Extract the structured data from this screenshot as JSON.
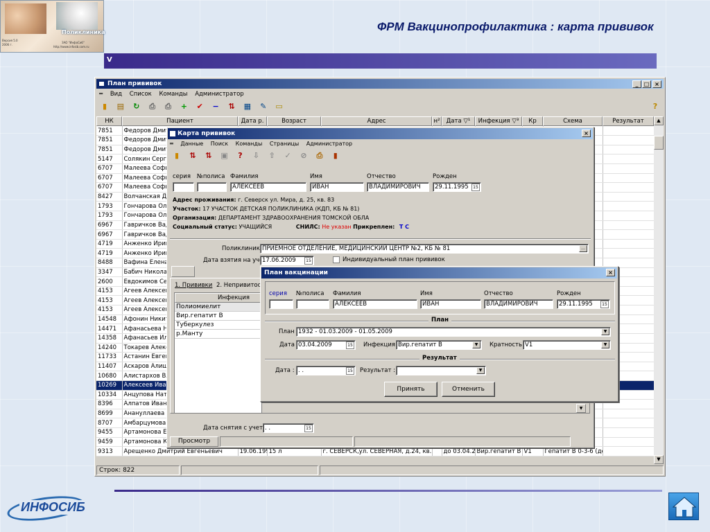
{
  "slide": {
    "title": "ФРМ Вакцинопрофилактика : карта прививок",
    "logo_text": "ИНФОСИБ",
    "tag": "V",
    "banner_brand": "Поликлиника",
    "banner_lines": [
      "Версия 5.0",
      "2006 г.",
      "ЗАО \"ИнфоСиб\"",
      "http://www.infosib.com.ru"
    ]
  },
  "main_window": {
    "title": "План прививок",
    "menu": [
      "Вид",
      "Список",
      "Команды",
      "Администратор"
    ],
    "columns": [
      "НК",
      "Пациент",
      "Дата р.",
      "Возраст",
      "Адрес",
      "н²",
      "Дата",
      "Инфекция",
      "Кр",
      "Схема",
      "Результат"
    ],
    "col_sort": {
      "date": "▽¹",
      "inf": "▽³"
    },
    "rows": [
      [
        "7851",
        "Федоров Дмитрий"
      ],
      [
        "7851",
        "Федоров Дмитрий"
      ],
      [
        "7851",
        "Федоров Дмитрий"
      ],
      [
        "5147",
        "Солякин Сергей"
      ],
      [
        "6707",
        "Малеева Софья"
      ],
      [
        "6707",
        "Малеева Софья"
      ],
      [
        "6707",
        "Малеева Софья"
      ],
      [
        "8427",
        "Волчанская Диана"
      ],
      [
        "1793",
        "Гончарова Ольга"
      ],
      [
        "1793",
        "Гончарова Ольга"
      ],
      [
        "6967",
        "Гавричков Вадим"
      ],
      [
        "6967",
        "Гавричков Вадим"
      ],
      [
        "4719",
        "Анженко Ирина"
      ],
      [
        "4719",
        "Анженко Ирина"
      ],
      [
        "8488",
        "Вафина Елена"
      ],
      [
        "3347",
        "Бабич Николай"
      ],
      [
        "2600",
        "Евдокимов Сергей"
      ],
      [
        "4153",
        "Агеев Алексей"
      ],
      [
        "4153",
        "Агеев Алексей"
      ],
      [
        "4153",
        "Агеев Алексей"
      ],
      [
        "14548",
        "Афонин Никита"
      ],
      [
        "14471",
        "Афанасьева Наталья"
      ],
      [
        "14358",
        "Афанасьев Илья"
      ],
      [
        "14240",
        "Токарев Алексей"
      ],
      [
        "11733",
        "Астанин Евгений"
      ],
      [
        "11407",
        "Аскаров Алишер"
      ],
      [
        "10680",
        "Алистархов Влад"
      ],
      [
        "10269",
        "Алексеев Иван"
      ],
      [
        "10334",
        "Анцупова Наталья"
      ],
      [
        "8396",
        "Алпатов Иван"
      ],
      [
        "8699",
        "Анануллаева Гульнара"
      ],
      [
        "8707",
        "Амбарцумова Мария"
      ],
      [
        "9455",
        "Артамонова Екатерина"
      ],
      [
        "9459",
        "Артамонова Ксения"
      ]
    ],
    "last_row": {
      "nk": "9313",
      "name": "Арещенко Дмитрий Евгеньевич",
      "dob": "19.06.1993",
      "age": "15 л",
      "addr": "г. СЕВЕРСК,ул. СЕВЕРНАЯ, д.24, кв.56",
      "date": "до 03.04.2009",
      "inf": "Вир.гепатит В",
      "kr": "V1",
      "scheme": "Гепатит В 0-3-6 (де"
    },
    "status": "Строк: 822"
  },
  "card": {
    "title": "Карта прививок",
    "menu": [
      "Данные",
      "Поиск",
      "Команды",
      "Страницы",
      "Администратор"
    ],
    "labels": {
      "seria": "серия",
      "polis": "№полиса",
      "fam": "Фамилия",
      "name": "Имя",
      "otch": "Отчество",
      "born": "Рожден"
    },
    "fam": "АЛЕКСЕЕВ",
    "name": "ИВАН",
    "otch": "ВЛАДИМИРОВИЧ",
    "born": "29.11.1995",
    "address_label": "Адрес проживания:",
    "address": "г. Северск ул. Мира, д. 25, кв. 83",
    "uchastok_label": "Участок:",
    "uchastok": "17 УЧАСТОК ДЕТСКАЯ ПОЛИКЛИНИКА (КДП, КБ № 81)",
    "org_label": "Организация:",
    "org": "ДЕПАРТАМЕНТ ЗДРАВООХРАНЕНИЯ ТОМСКОЙ ОБЛА",
    "social_label": "Социальный статус:",
    "social": "УЧАЩИЙСЯ",
    "snils_label": "СНИЛС:",
    "snils": "Не указан",
    "prikr_label": "Прикреплен:",
    "prikr": "Т С",
    "poly_label": "Поликлиника",
    "poly": "ПРИЕМНОЕ ОТДЕЛЕНИЕ, МЕДИЦИНСКИЙ ЦЕНТР №2, КБ № 81",
    "date_taken_label": "Дата взятия на учет",
    "date_taken": "17.06.2009",
    "individual": "Индивидуальный план прививок",
    "tabs": [
      "1. Прививки",
      "2. Непривитость"
    ],
    "inf_header": "Инфекция",
    "infections": [
      "Полиомиелит",
      "Вир.гепатит В",
      "Туберкулез",
      "р.Манту"
    ],
    "date_removed_label": "Дата снятия с учета",
    "date_removed": ". .",
    "view_tab": "Просмотр"
  },
  "plan": {
    "title": "План вакцинации",
    "labels": {
      "seria": "серия",
      "polis": "№полиса",
      "fam": "Фамилия",
      "name": "Имя",
      "otch": "Отчество",
      "born": "Рожден"
    },
    "fam": "АЛЕКСЕЕВ",
    "name": "ИВАН",
    "otch": "ВЛАДИМИРОВИЧ",
    "born": "29.11.1995",
    "section_plan": "План",
    "plan_label": "План",
    "plan_value": "1932 - 01.03.2009 - 01.05.2009",
    "date_label": "Дата",
    "date": "03.04.2009",
    "inf_label": "Инфекция",
    "inf": "Вир.гепатит В",
    "krat_label": "Кратность",
    "krat": "V1",
    "section_result": "Результат",
    "rdate_label": "Дата :",
    "rdate": ". .",
    "result_label": "Результат :",
    "result": "",
    "ok": "Принять",
    "cancel": "Отменить"
  }
}
